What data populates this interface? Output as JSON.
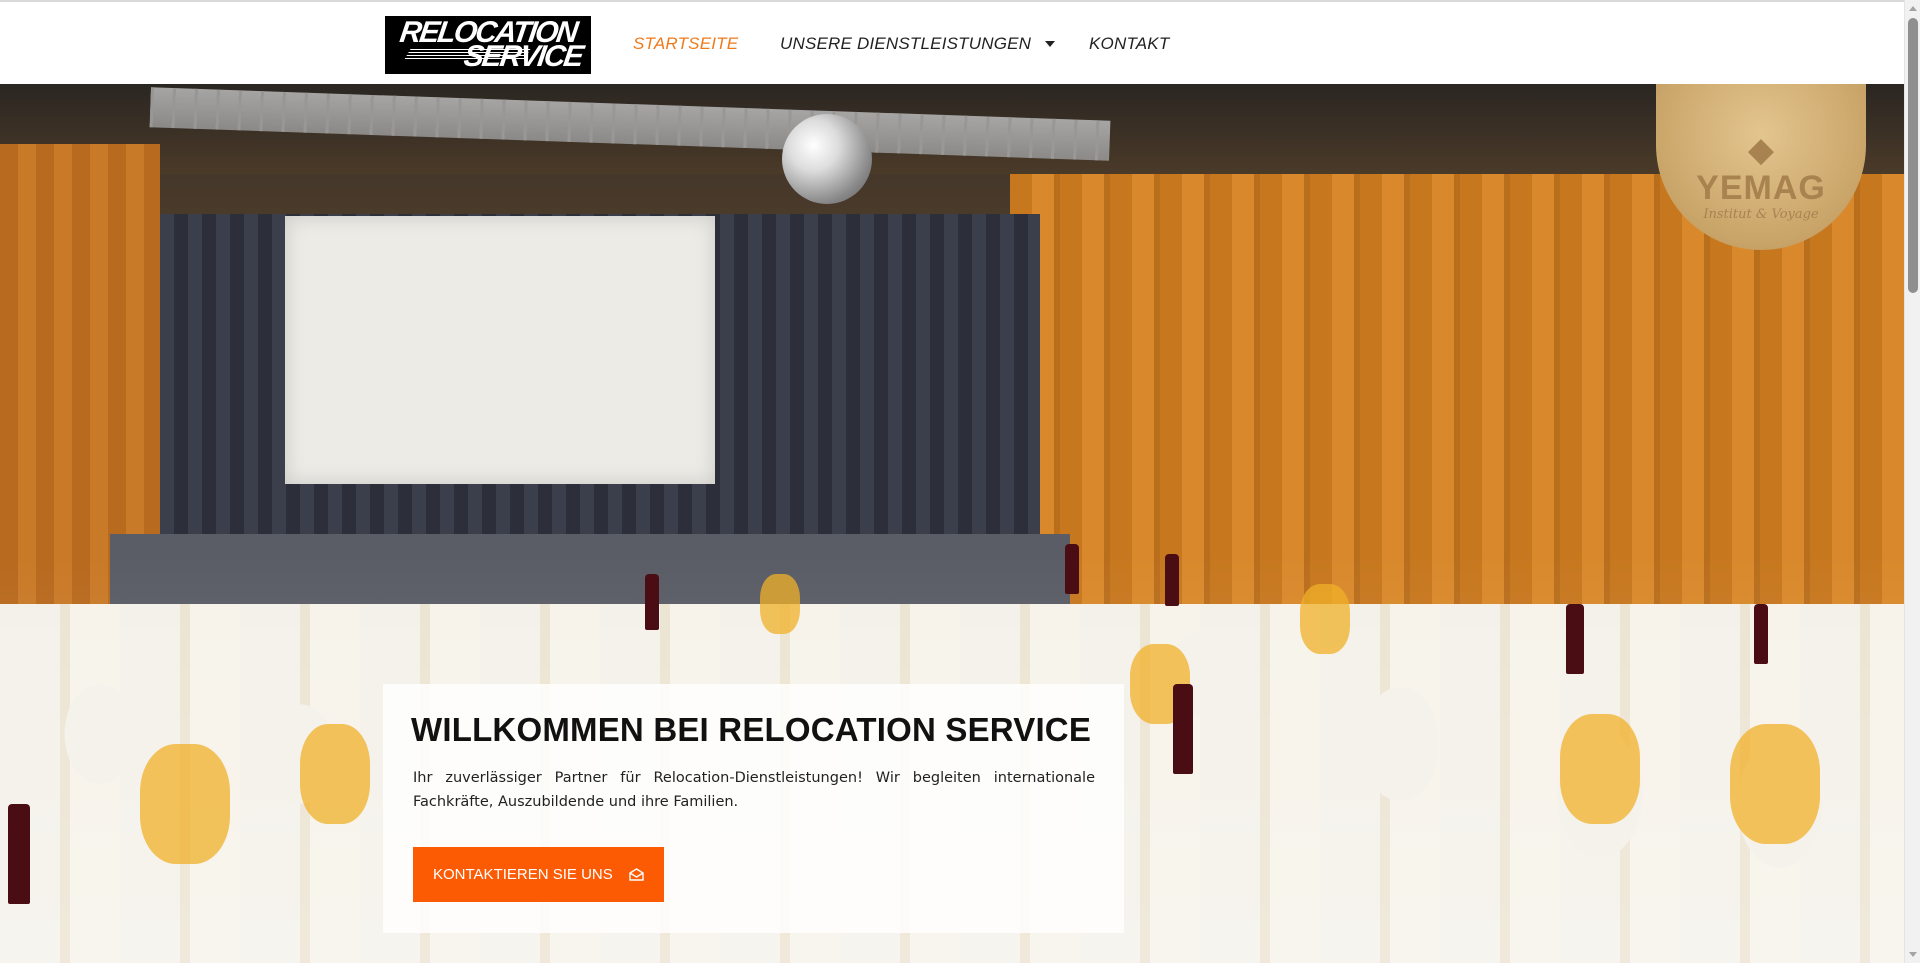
{
  "header": {
    "logo": {
      "line1": "RELOCATION",
      "line2": "SERVICE",
      "icon": "relocation-service-logo"
    },
    "nav": [
      {
        "label": "STARTSEITE",
        "active": true
      },
      {
        "label": "UNSERE DIENSTLEISTUNGEN",
        "has_dropdown": true,
        "icon": "chevron-down-icon"
      },
      {
        "label": "KONTAKT",
        "active": false
      }
    ]
  },
  "hero": {
    "background_image": "banquet-hall-photo",
    "watermark": {
      "name": "YEMAG",
      "subtitle": "Institut & Voyage",
      "icon": "origami-bird-icon"
    },
    "title": "WILLKOMMEN BEI RELOCATION SERVICE",
    "text": "Ihr zuverlässiger Partner für Relocation-Dienstleistungen! Wir begleiten internationale Fachkräfte, Auszubildende und ihre Familien.",
    "cta": {
      "label": "KONTAKTIEREN SIE UNS",
      "icon": "envelope-open-icon"
    }
  },
  "colors": {
    "accent": "#ee7a1c",
    "button": "#fc5b04",
    "text": "#111111"
  }
}
